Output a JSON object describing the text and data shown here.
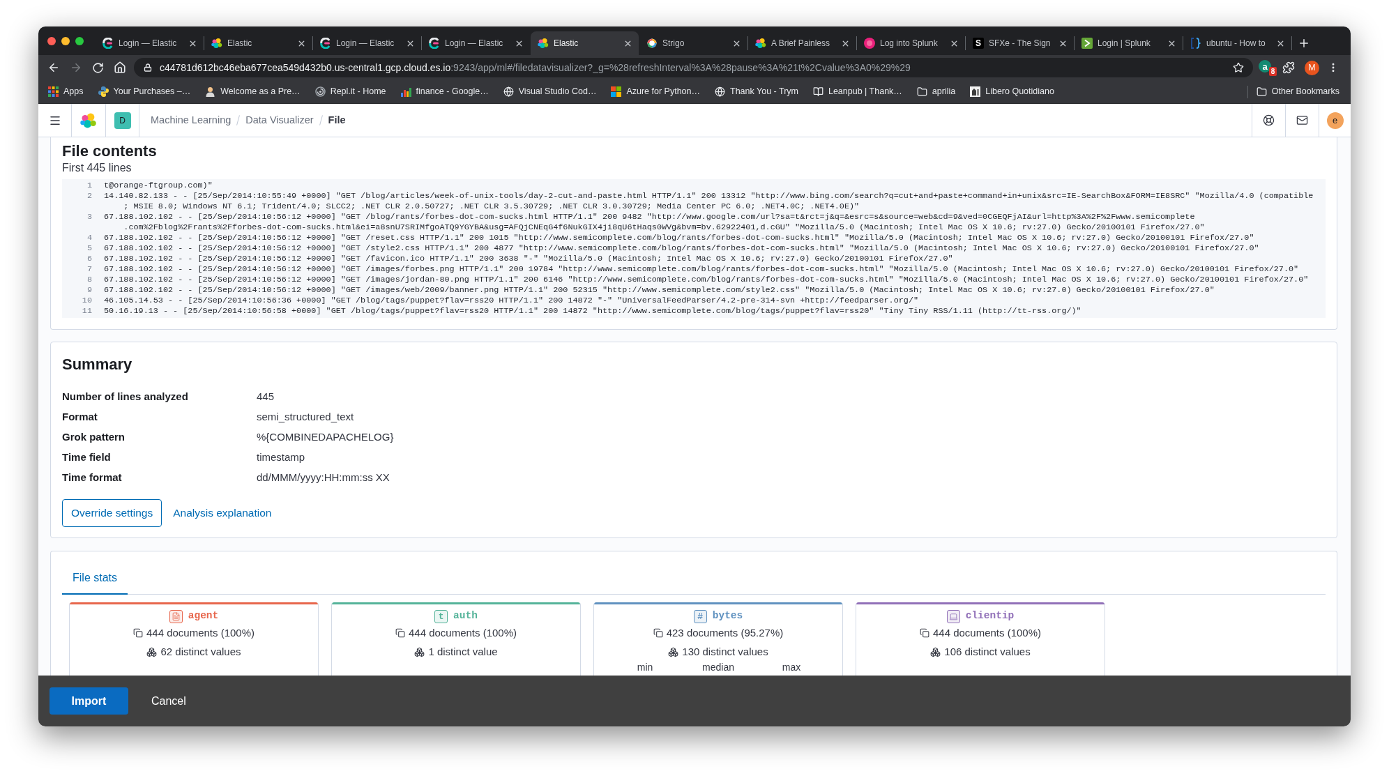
{
  "browser": {
    "tabs": [
      {
        "title": "Login — Elastic",
        "kind": "elastic-cloud",
        "selected": false
      },
      {
        "title": "Elastic",
        "kind": "elastic",
        "selected": false
      },
      {
        "title": "Login — Elastic",
        "kind": "elastic-cloud",
        "selected": false
      },
      {
        "title": "Login — Elastic",
        "kind": "elastic-cloud",
        "selected": false
      },
      {
        "title": "Elastic",
        "kind": "elastic",
        "selected": true
      },
      {
        "title": "Strigo",
        "kind": "strigo",
        "selected": false
      },
      {
        "title": "A Brief Painless",
        "kind": "elastic",
        "selected": false
      },
      {
        "title": "Log into Splunk",
        "kind": "splunk",
        "selected": false
      },
      {
        "title": "SFXe - The Sign",
        "kind": "letter",
        "icon_text": "S",
        "selected": false
      },
      {
        "title": "Login | Splunk",
        "kind": "terminal",
        "selected": false
      },
      {
        "title": "ubuntu - How to",
        "kind": "bracket",
        "selected": false
      }
    ],
    "forward_disabled": true,
    "address": {
      "host": "c44781d612bc46eba677cea549d432b0.us-central1.gcp.cloud.es.io",
      "path": ":9243/app/ml#/filedatavisualizer?_g=%28refreshInterval%3A%28pause%3A%21t%2Cvalue%3A0%29%29"
    },
    "extension": {
      "letter": "a",
      "badge": "8"
    },
    "profile": "M",
    "bookmarks": [
      {
        "label": "Apps",
        "kind": "grid"
      },
      {
        "label": "Your Purchases –…",
        "kind": "python"
      },
      {
        "label": "Welcome as a Pre…",
        "kind": "person"
      },
      {
        "label": "Repl.it - Home",
        "kind": "swirl"
      },
      {
        "label": "finance - Google…",
        "kind": "chart"
      },
      {
        "label": "Visual Studio Cod…",
        "kind": "globe"
      },
      {
        "label": "Azure for Python…",
        "kind": "windows"
      },
      {
        "label": "Thank You - Trym",
        "kind": "globe"
      },
      {
        "label": "Leanpub | Thank…",
        "kind": "book"
      },
      {
        "label": "aprilia",
        "kind": "folder"
      },
      {
        "label": "Libero Quotidiano",
        "kind": "newspaper"
      }
    ],
    "other_bookmarks": "Other Bookmarks"
  },
  "app": {
    "space": "D",
    "breadcrumbs": [
      {
        "label": "Machine Learning",
        "current": false
      },
      {
        "label": "Data Visualizer",
        "current": false
      },
      {
        "label": "File",
        "current": true
      }
    ],
    "user": "e"
  },
  "file_contents": {
    "title": "File contents",
    "subtitle": "First 445 lines",
    "lines": [
      {
        "number": "1",
        "rows": [
          "t@orange-ftgroup.com)\""
        ]
      },
      {
        "number": "2",
        "rows": [
          "14.140.82.133 - - [25/Sep/2014:10:55:49 +0000] \"GET /blog/articles/week-of-unix-tools/day-2-cut-and-paste.html HTTP/1.1\" 200 13312 \"http://www.bing.com/search?q=cut+and+paste+command+in+unix&src=IE-SearchBox&FORM=IE8SRC\" \"Mozilla/4.0 (compatible",
          "; MSIE 8.0; Windows NT 6.1; Trident/4.0; SLCC2; .NET CLR 2.0.50727; .NET CLR 3.5.30729; .NET CLR 3.0.30729; Media Center PC 6.0; .NET4.0C; .NET4.0E)\""
        ]
      },
      {
        "number": "3",
        "rows": [
          "67.188.102.102 - - [25/Sep/2014:10:56:12 +0000] \"GET /blog/rants/forbes-dot-com-sucks.html HTTP/1.1\" 200 9482 \"http://www.google.com/url?sa=t&rct=j&q=&esrc=s&source=web&cd=9&ved=0CGEQFjAI&url=http%3A%2F%2Fwww.semicomplete",
          ".com%2Fblog%2Frants%2Fforbes-dot-com-sucks.html&ei=a8snU7SRIMfgoATQ9YGYBA&usg=AFQjCNEqG4f6NukGIX4ji8qU6tHaqs0WVg&bvm=bv.62922401,d.cGU\" \"Mozilla/5.0 (Macintosh; Intel Mac OS X 10.6; rv:27.0) Gecko/20100101 Firefox/27.0\""
        ]
      },
      {
        "number": "4",
        "rows": [
          "67.188.102.102 - - [25/Sep/2014:10:56:12 +0000] \"GET /reset.css HTTP/1.1\" 200 1015 \"http://www.semicomplete.com/blog/rants/forbes-dot-com-sucks.html\" \"Mozilla/5.0 (Macintosh; Intel Mac OS X 10.6; rv:27.0) Gecko/20100101 Firefox/27.0\""
        ]
      },
      {
        "number": "5",
        "rows": [
          "67.188.102.102 - - [25/Sep/2014:10:56:12 +0000] \"GET /style2.css HTTP/1.1\" 200 4877 \"http://www.semicomplete.com/blog/rants/forbes-dot-com-sucks.html\" \"Mozilla/5.0 (Macintosh; Intel Mac OS X 10.6; rv:27.0) Gecko/20100101 Firefox/27.0\""
        ]
      },
      {
        "number": "6",
        "rows": [
          "67.188.102.102 - - [25/Sep/2014:10:56:12 +0000] \"GET /favicon.ico HTTP/1.1\" 200 3638 \"-\" \"Mozilla/5.0 (Macintosh; Intel Mac OS X 10.6; rv:27.0) Gecko/20100101 Firefox/27.0\""
        ]
      },
      {
        "number": "7",
        "rows": [
          "67.188.102.102 - - [25/Sep/2014:10:56:12 +0000] \"GET /images/forbes.png HTTP/1.1\" 200 19784 \"http://www.semicomplete.com/blog/rants/forbes-dot-com-sucks.html\" \"Mozilla/5.0 (Macintosh; Intel Mac OS X 10.6; rv:27.0) Gecko/20100101 Firefox/27.0\""
        ]
      },
      {
        "number": "8",
        "rows": [
          "67.188.102.102 - - [25/Sep/2014:10:56:12 +0000] \"GET /images/jordan-80.png HTTP/1.1\" 200 6146 \"http://www.semicomplete.com/blog/rants/forbes-dot-com-sucks.html\" \"Mozilla/5.0 (Macintosh; Intel Mac OS X 10.6; rv:27.0) Gecko/20100101 Firefox/27.0\""
        ]
      },
      {
        "number": "9",
        "rows": [
          "67.188.102.102 - - [25/Sep/2014:10:56:12 +0000] \"GET /images/web/2009/banner.png HTTP/1.1\" 200 52315 \"http://www.semicomplete.com/style2.css\" \"Mozilla/5.0 (Macintosh; Intel Mac OS X 10.6; rv:27.0) Gecko/20100101 Firefox/27.0\""
        ]
      },
      {
        "number": "10",
        "rows": [
          "46.105.14.53 - - [25/Sep/2014:10:56:36 +0000] \"GET /blog/tags/puppet?flav=rss20 HTTP/1.1\" 200 14872 \"-\" \"UniversalFeedParser/4.2-pre-314-svn +http://feedparser.org/\""
        ]
      },
      {
        "number": "11",
        "rows": [
          "50.16.19.13 - - [25/Sep/2014:10:56:58 +0000] \"GET /blog/tags/puppet?flav=rss20 HTTP/1.1\" 200 14872 \"http://www.semicomplete.com/blog/tags/puppet?flav=rss20\" \"Tiny Tiny RSS/1.11 (http://tt-rss.org/)\""
        ]
      }
    ]
  },
  "summary": {
    "title": "Summary",
    "rows": [
      {
        "label": "Number of lines analyzed",
        "value": "445"
      },
      {
        "label": "Format",
        "value": "semi_structured_text"
      },
      {
        "label": "Grok pattern",
        "value": "%{COMBINEDAPACHELOG}"
      },
      {
        "label": "Time field",
        "value": "timestamp"
      },
      {
        "label": "Time format",
        "value": "dd/MMM/yyyy:HH:mm:ss XX"
      }
    ],
    "actions": [
      {
        "label": "Override settings",
        "kind": "outline"
      },
      {
        "label": "Analysis explanation",
        "kind": "link"
      }
    ]
  },
  "file_stats": {
    "tabs": [
      {
        "label": "File stats",
        "selected": true
      }
    ],
    "fields": [
      {
        "name": "agent",
        "kind": "document",
        "color": "#e7664c",
        "documents": "444 documents (100%)",
        "distinct": "62 distinct values"
      },
      {
        "name": "auth",
        "kind": "glyph",
        "glyph": "t",
        "color": "#54b399",
        "documents": "444 documents (100%)",
        "distinct": "1 distinct value"
      },
      {
        "name": "bytes",
        "kind": "glyph",
        "glyph": "#",
        "color": "#6092c0",
        "documents": "423 documents (95.27%)",
        "distinct": "130 distinct values",
        "stats": [
          "min",
          "median",
          "max"
        ]
      },
      {
        "name": "clientip",
        "kind": "computer",
        "color": "#9170b8",
        "documents": "444 documents (100%)",
        "distinct": "106 distinct values"
      }
    ]
  },
  "footer": {
    "buttons": [
      {
        "label": "Import",
        "kind": "primary"
      },
      {
        "label": "Cancel",
        "kind": "ghost"
      }
    ]
  }
}
